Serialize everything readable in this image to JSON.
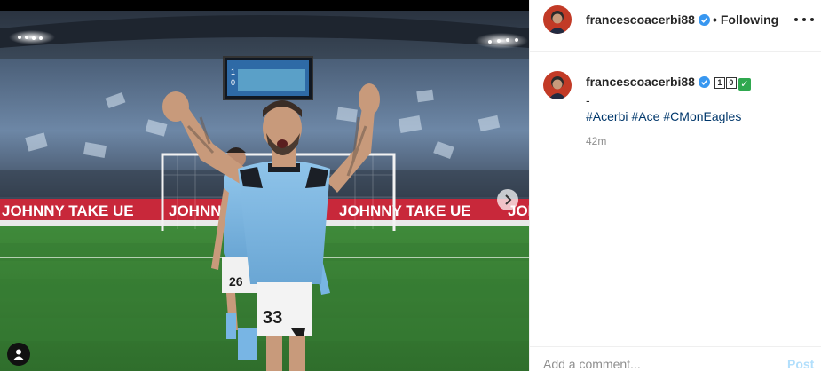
{
  "post": {
    "username": "francescoacerbi88",
    "verified": true,
    "follow_separator": "•",
    "follow_status": "Following",
    "caption": {
      "username": "francescoacerbi88",
      "emoji_box_1": "1",
      "emoji_box_2": "0",
      "emoji_check": "✓",
      "dash": "-",
      "hashtags": [
        "#Acerbi",
        "#Ace",
        "#CMonEagles"
      ]
    },
    "time_ago": "42m"
  },
  "photo": {
    "banner_text": "JOHNNY TAKE UE",
    "banner_text_2": "JOHNNY TAKE UE",
    "banner_text_3": "JOHNNY TAKE UE",
    "banner_text_4": "JOHNNY",
    "banner_text_5": "JOHNNY TAKE UE",
    "banner_text_6": "JOI",
    "scoreboard_home": "1",
    "scoreboard_away": "0",
    "jersey_number_main": "33",
    "jersey_number_back": "26"
  },
  "comment": {
    "placeholder": "Add a comment...",
    "post_label": "Post"
  },
  "colors": {
    "link": "#00376b",
    "verified": "#3897f0",
    "post_disabled": "#b2dffc",
    "banner_red": "#c8283a"
  },
  "icons": [
    "verified-badge-icon",
    "more-options-icon",
    "next-arrow-icon",
    "user-tag-icon"
  ]
}
